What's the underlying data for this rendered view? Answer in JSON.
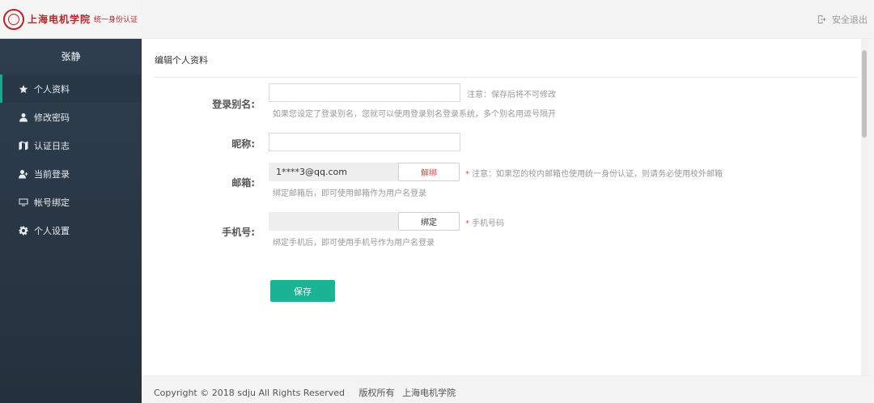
{
  "brand": {
    "name": "上海电机学院",
    "sub": "统一身份认证"
  },
  "header": {
    "logout_label": "安全退出"
  },
  "sidebar": {
    "user_name": "张静",
    "items": [
      {
        "label": "个人资料",
        "icon": "star-icon"
      },
      {
        "label": "修改密码",
        "icon": "user-icon"
      },
      {
        "label": "认证日志",
        "icon": "map-icon"
      },
      {
        "label": "当前登录",
        "icon": "user-add-icon"
      },
      {
        "label": "帐号绑定",
        "icon": "monitor-icon"
      },
      {
        "label": "个人设置",
        "icon": "gear-icon"
      }
    ]
  },
  "panel": {
    "title": "编辑个人资料"
  },
  "form": {
    "alias": {
      "label": "登录别名:",
      "value": "",
      "note": "注意：保存后将不可修改",
      "hint": "如果您设定了登录别名，您就可以使用登录别名登录系统，多个别名用逗号隔开"
    },
    "nickname": {
      "label": "昵称:",
      "value": ""
    },
    "email": {
      "label": "邮箱:",
      "value": "1****3@qq.com",
      "button": "解绑",
      "note": "注意：如果您的校内邮箱也使用统一身份认证，则请务必使用校外邮箱",
      "hint": "绑定邮箱后，即可使用邮箱作为用户名登录"
    },
    "phone": {
      "label": "手机号:",
      "value": "",
      "button": "绑定",
      "note": "手机号码",
      "hint": "绑定手机后，即可使用手机号作为用户名登录"
    },
    "save_label": "保存"
  },
  "footer": {
    "copyright": "Copyright © 2018 sdju All Rights Reserved",
    "rights": "版权所有",
    "org": "上海电机学院"
  },
  "colors": {
    "sidebar_bg": "#2f4050",
    "accent": "#1ab394",
    "danger": "#e44747",
    "brand_red": "#b8242a"
  }
}
